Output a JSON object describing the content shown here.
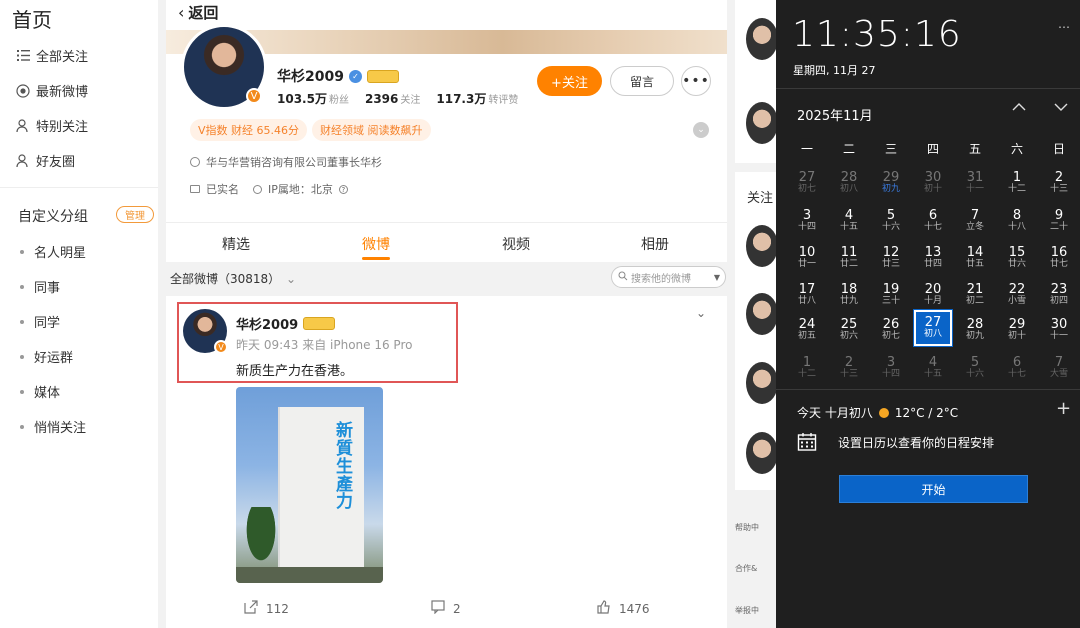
{
  "sidebar": {
    "title": "首页",
    "items": [
      {
        "label": "全部关注",
        "icon": "list-icon"
      },
      {
        "label": "最新微博",
        "icon": "record-icon"
      },
      {
        "label": "特别关注",
        "icon": "user-star-icon"
      },
      {
        "label": "好友圈",
        "icon": "friends-icon"
      }
    ],
    "group_title": "自定义分组",
    "manage_label": "管理",
    "groups": [
      "名人明星",
      "同事",
      "同学",
      "好运群",
      "媒体",
      "悄悄关注"
    ]
  },
  "profile": {
    "back_label": "返回",
    "name": "华杉2009",
    "followers_value": "103.5万",
    "followers_unit": "粉丝",
    "following_value": "2396",
    "following_unit": "关注",
    "likes_value": "117.3万",
    "likes_unit": "转评赞",
    "follow_label": "+关注",
    "message_label": "留言",
    "tags": [
      "V指数 财经 65.46分",
      "财经领域 阅读数飙升"
    ],
    "bio": "华与华营销咨询有限公司董事长华杉",
    "verified": "已实名",
    "ip": "IP属地：北京"
  },
  "tabs": [
    {
      "label": "精选",
      "active": false
    },
    {
      "label": "微博",
      "active": true
    },
    {
      "label": "视频",
      "active": false
    },
    {
      "label": "相册",
      "active": false
    }
  ],
  "filter": {
    "label": "全部微博（30818）",
    "search_placeholder": "搜索他的微博"
  },
  "post": {
    "author": "华杉2009",
    "meta": "昨天 09:43 来自 iPhone 16 Pro",
    "text": "新质生产力在香港。",
    "image_text": "新質生產力",
    "reposts": "112",
    "comments": "2",
    "likes": "1476"
  },
  "right": {
    "follow_title": "关注",
    "footer": [
      "帮助中",
      "合作&",
      "举报中"
    ]
  },
  "flyout": {
    "time": "11:35:16",
    "date": "星期四, 11月 27",
    "month": "2025年11月",
    "weekdays": [
      "一",
      "二",
      "三",
      "四",
      "五",
      "六",
      "日"
    ],
    "days": [
      {
        "n": "27",
        "l": "初七",
        "dim": true
      },
      {
        "n": "28",
        "l": "初八",
        "dim": true
      },
      {
        "n": "29",
        "l": "初九",
        "dim": true,
        "hl": true
      },
      {
        "n": "30",
        "l": "初十",
        "dim": true
      },
      {
        "n": "31",
        "l": "十一",
        "dim": true
      },
      {
        "n": "1",
        "l": "十二"
      },
      {
        "n": "2",
        "l": "十三"
      },
      {
        "n": "3",
        "l": "十四"
      },
      {
        "n": "4",
        "l": "十五"
      },
      {
        "n": "5",
        "l": "十六"
      },
      {
        "n": "6",
        "l": "十七"
      },
      {
        "n": "7",
        "l": "立冬"
      },
      {
        "n": "8",
        "l": "十八"
      },
      {
        "n": "9",
        "l": "二十"
      },
      {
        "n": "10",
        "l": "廿一"
      },
      {
        "n": "11",
        "l": "廿二"
      },
      {
        "n": "12",
        "l": "廿三"
      },
      {
        "n": "13",
        "l": "廿四"
      },
      {
        "n": "14",
        "l": "廿五"
      },
      {
        "n": "15",
        "l": "廿六"
      },
      {
        "n": "16",
        "l": "廿七"
      },
      {
        "n": "17",
        "l": "廿八"
      },
      {
        "n": "18",
        "l": "廿九"
      },
      {
        "n": "19",
        "l": "三十"
      },
      {
        "n": "20",
        "l": "十月"
      },
      {
        "n": "21",
        "l": "初二"
      },
      {
        "n": "22",
        "l": "小雪"
      },
      {
        "n": "23",
        "l": "初四"
      },
      {
        "n": "24",
        "l": "初五"
      },
      {
        "n": "25",
        "l": "初六"
      },
      {
        "n": "26",
        "l": "初七"
      },
      {
        "n": "27",
        "l": "初八",
        "today": true
      },
      {
        "n": "28",
        "l": "初九"
      },
      {
        "n": "29",
        "l": "初十"
      },
      {
        "n": "30",
        "l": "十一"
      },
      {
        "n": "1",
        "l": "十二",
        "dim": true
      },
      {
        "n": "2",
        "l": "十三",
        "dim": true
      },
      {
        "n": "3",
        "l": "十四",
        "dim": true
      },
      {
        "n": "4",
        "l": "十五",
        "dim": true
      },
      {
        "n": "5",
        "l": "十六",
        "dim": true
      },
      {
        "n": "6",
        "l": "十七",
        "dim": true
      },
      {
        "n": "7",
        "l": "大雪",
        "dim": true
      }
    ],
    "today_label": "今天 十月初八",
    "weather": "12°C / 2°C",
    "calendar_hint": "设置日历以查看你的日程安排",
    "start_label": "开始"
  },
  "colors": {
    "accent": "#ff8200",
    "flyout_bg": "#1f1f1f",
    "today": "#0a64c8",
    "highlight": "#e05656"
  }
}
